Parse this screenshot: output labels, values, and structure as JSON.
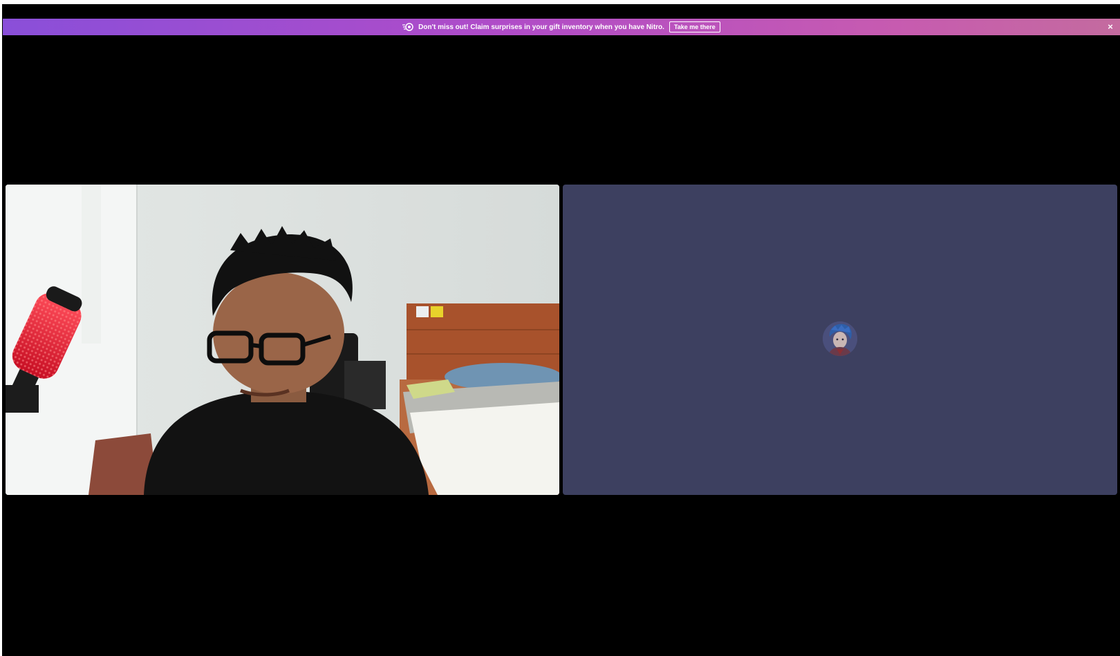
{
  "banner": {
    "message": "Don't miss out! Claim surprises in your gift inventory when you have Nitro.",
    "cta_label": "Take me there",
    "close_glyph": "×",
    "icon": "gift-icon",
    "gradient_colors": [
      "#8a4fd9",
      "#c46b9f"
    ]
  },
  "call": {
    "participants": [
      {
        "type": "camera-video",
        "background": "#dfe3e1"
      },
      {
        "type": "avatar",
        "background": "#3d4060"
      }
    ]
  },
  "colors": {
    "stage_background": "#000000",
    "tile_empty": "#3d4060"
  }
}
